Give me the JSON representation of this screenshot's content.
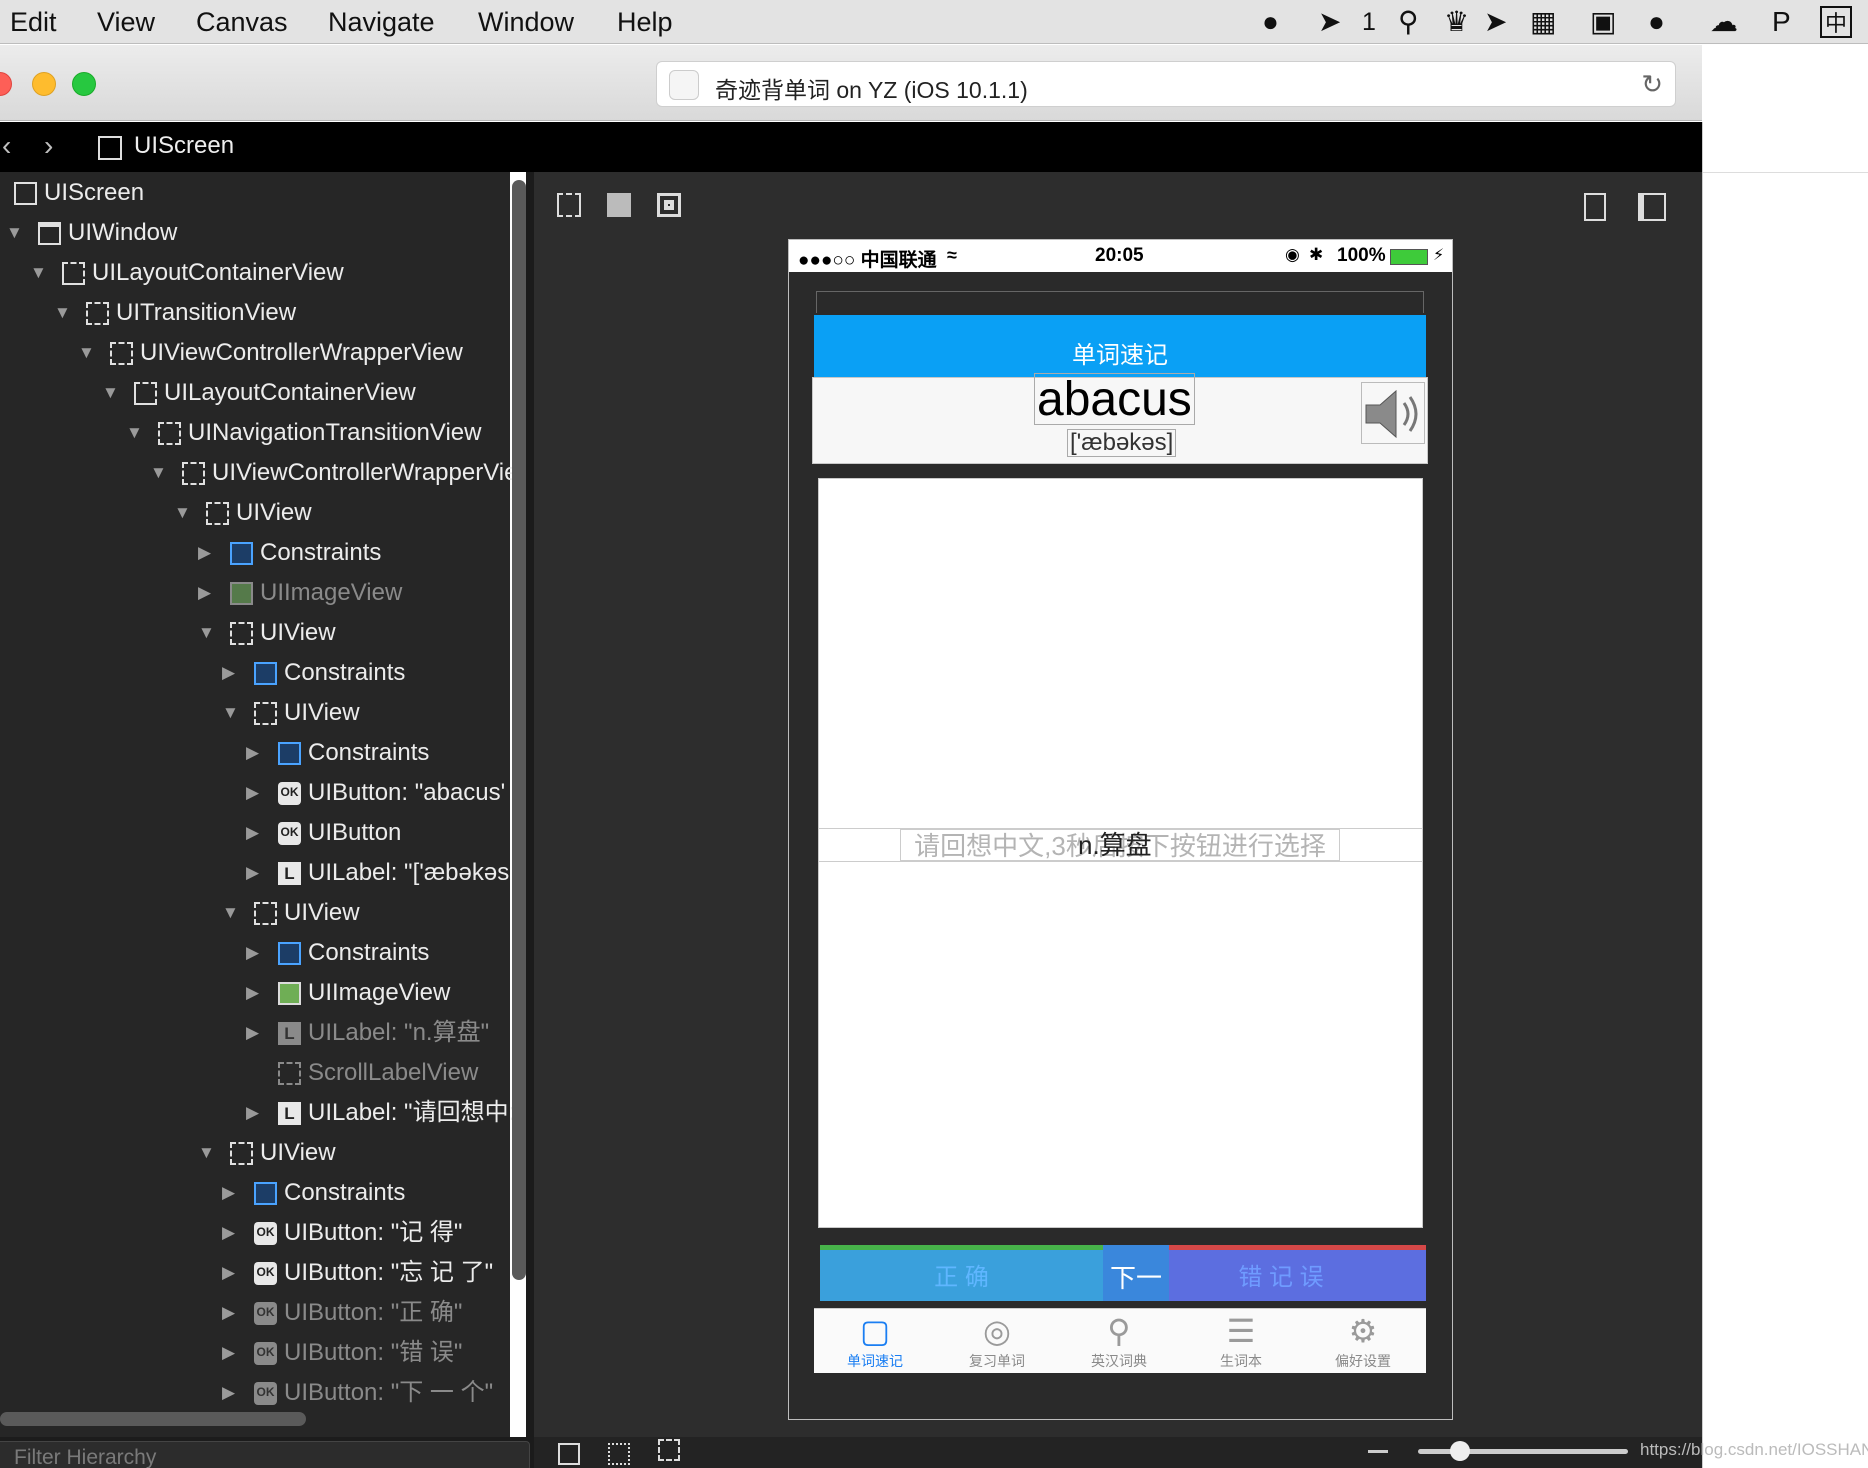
{
  "menubar": {
    "items": [
      "Edit",
      "View",
      "Canvas",
      "Navigate",
      "Window",
      "Help"
    ],
    "status_icons": [
      "qq-icon",
      "bird-icon",
      "search-icon",
      "evernote-icon",
      "send-icon",
      "keyboard-icon",
      "screenshot-icon",
      "wechat-icon",
      "cloud-icon",
      "p-icon",
      "ime-icon"
    ],
    "badge_count": "1",
    "ime_label": "中"
  },
  "window": {
    "title": "奇迹背单词 on YZ (iOS 10.1.1)",
    "breadcrumb": "UIScreen"
  },
  "hierarchy": {
    "filter_placeholder": "Filter Hierarchy",
    "rows": [
      {
        "label": "UIScreen",
        "icon": "screen"
      },
      {
        "label": "UIWindow",
        "icon": "window"
      },
      {
        "label": "UILayoutContainerView",
        "icon": "layout"
      },
      {
        "label": "UITransitionView",
        "icon": "view"
      },
      {
        "label": "UIViewControllerWrapperView",
        "icon": "view"
      },
      {
        "label": "UILayoutContainerView",
        "icon": "layout"
      },
      {
        "label": "UINavigationTransitionView",
        "icon": "view"
      },
      {
        "label": "UIViewControllerWrapperVie",
        "icon": "view"
      },
      {
        "label": "UIView",
        "icon": "view"
      },
      {
        "label": "Constraints",
        "icon": "constraints"
      },
      {
        "label": "UIImageView",
        "icon": "image"
      },
      {
        "label": "UIView",
        "icon": "view"
      },
      {
        "label": "Constraints",
        "icon": "constraints"
      },
      {
        "label": "UIView",
        "icon": "view"
      },
      {
        "label": "Constraints",
        "icon": "constraints"
      },
      {
        "label": "UIButton: \"abacus'",
        "icon": "button"
      },
      {
        "label": "UIButton",
        "icon": "button"
      },
      {
        "label": "UILabel: \"['æbəkəs",
        "icon": "label"
      },
      {
        "label": "UIView",
        "icon": "view"
      },
      {
        "label": "Constraints",
        "icon": "constraints"
      },
      {
        "label": "UIImageView",
        "icon": "image"
      },
      {
        "label": "UILabel: \"n.算盘\"",
        "icon": "label"
      },
      {
        "label": "ScrollLabelView",
        "icon": "view"
      },
      {
        "label": "UILabel: \"请回想中:",
        "icon": "label"
      },
      {
        "label": "UIView",
        "icon": "view"
      },
      {
        "label": "Constraints",
        "icon": "constraints"
      },
      {
        "label": "UIButton: \"记    得\"",
        "icon": "button"
      },
      {
        "label": "UIButton: \"忘 记 了\"",
        "icon": "button"
      },
      {
        "label": "UIButton: \"正    确\"",
        "icon": "button"
      },
      {
        "label": "UIButton: \"错    误\"",
        "icon": "button"
      },
      {
        "label": "UIButton: \"下 一 个\"",
        "icon": "button"
      }
    ]
  },
  "phone": {
    "carrier": "●●●○○ 中国联通",
    "time": "20:05",
    "battery": "100%",
    "nav_title": "单词速记",
    "word": "abacus",
    "phonetic": "['æbəkəs]",
    "hint": "请回想中文,3秒后按下按钮进行选择",
    "meaning": "n.算盘",
    "btn_correct": "正    确",
    "btn_next": "下一个",
    "btn_wrong": "错 记 误",
    "tabs": [
      {
        "label": "单词速记",
        "icon": "monitor-icon",
        "active": true
      },
      {
        "label": "复习单词",
        "icon": "target-icon",
        "active": false
      },
      {
        "label": "英汉词典",
        "icon": "search-icon",
        "active": false
      },
      {
        "label": "生词本",
        "icon": "notebook-icon",
        "active": false
      },
      {
        "label": "偏好设置",
        "icon": "gear-icon",
        "active": false
      }
    ]
  },
  "watermark": "https://blog.csdn.net/IOSSHAN",
  "colors": {
    "nav_blue": "#0aa0f5",
    "tab_active": "#1a7ef2",
    "correct_green": "#47b34a",
    "wrong_red": "#d54848"
  }
}
